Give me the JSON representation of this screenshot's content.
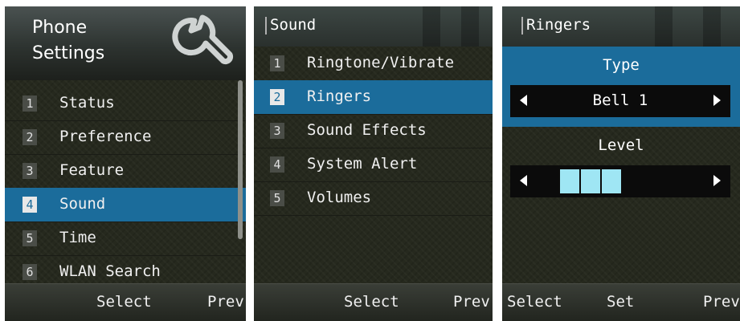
{
  "panel1": {
    "title_line1": "Phone",
    "title_line2": "Settings",
    "header_icon": "wrench-icon",
    "items": [
      {
        "num": "1",
        "label": "Status"
      },
      {
        "num": "2",
        "label": "Preference"
      },
      {
        "num": "3",
        "label": "Feature"
      },
      {
        "num": "4",
        "label": "Sound",
        "selected": true
      },
      {
        "num": "5",
        "label": "Time"
      },
      {
        "num": "6",
        "label": "WLAN Search"
      }
    ],
    "softkeys": {
      "center": "Select",
      "right": "Prev"
    }
  },
  "panel2": {
    "title": "Sound",
    "items": [
      {
        "num": "1",
        "label": "Ringtone/Vibrate"
      },
      {
        "num": "2",
        "label": "Ringers",
        "selected": true
      },
      {
        "num": "3",
        "label": "Sound Effects"
      },
      {
        "num": "4",
        "label": "System Alert"
      },
      {
        "num": "5",
        "label": "Volumes"
      }
    ],
    "softkeys": {
      "center": "Select",
      "right": "Prev"
    }
  },
  "panel3": {
    "title": "Ringers",
    "type_label": "Type",
    "type_value": "Bell 1",
    "level_label": "Level",
    "level_value": 3,
    "softkeys": {
      "left": "Select",
      "center": "Set",
      "right": "Prev"
    }
  },
  "colors": {
    "selected": "#1b6c9b",
    "level_fill": "#9fe6f4",
    "background": "#26291e"
  }
}
